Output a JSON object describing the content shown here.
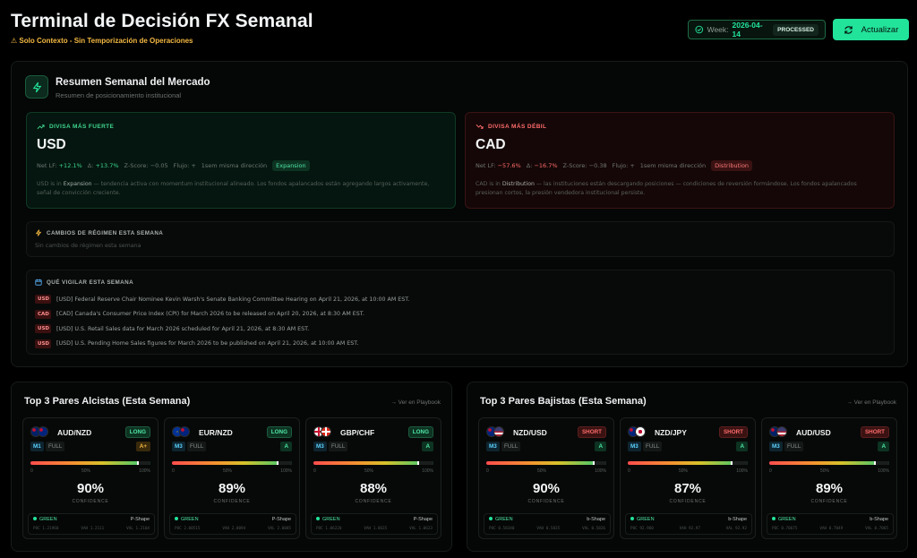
{
  "header": {
    "title": "Terminal de Decisión FX Semanal",
    "subtitle": "⚠ Solo Contexto - Sin Temporización de Operaciones",
    "week_label": "Week:",
    "week_value": "2026-04-14",
    "status": "PROCESSED",
    "refresh_label": "Actualizar"
  },
  "summary": {
    "title": "Resumen Semanal del Mercado",
    "subtitle": "Resumen de posicionamiento institucional",
    "strong": {
      "label": "DIVISA MÁS FUERTE",
      "currency": "USD",
      "net_lf_label": "Net LF:",
      "net_lf": "+12.1%",
      "delta_label": "Δ:",
      "delta": "+13.7%",
      "zscore": "Z-Score: −0.05",
      "flow": "Flujo: +",
      "same_dir": "1sem misma dirección",
      "regime": "Expansion",
      "desc_pre": "USD is in ",
      "desc_regime": "Expansion",
      "desc_post": " — tendencia activa con momentum institucional alineado. Los fondos apalancados están agregando largos activamente, señal de convicción creciente."
    },
    "weak": {
      "label": "DIVISA MÁS DÉBIL",
      "currency": "CAD",
      "net_lf_label": "Net LF:",
      "net_lf": "−57.6%",
      "delta_label": "Δ:",
      "delta": "−16.7%",
      "zscore": "Z-Score: −0.38",
      "flow": "Flujo: +",
      "same_dir": "1sem misma dirección",
      "regime": "Distribution",
      "desc_pre": "CAD is in ",
      "desc_regime": "Distribution",
      "desc_post": " — las instituciones están descargando posiciones — condiciones de reversión formándose. Los fondos apalancados presionan cortos, la presión vendedora institucional persiste."
    },
    "regime_changes": {
      "title": "CAMBIOS DE RÉGIMEN ESTA SEMANA",
      "empty": "Sin cambios de régimen esta semana"
    },
    "watch": {
      "title": "QUÉ VIGILAR ESTA SEMANA",
      "events": [
        {
          "tag": "USD",
          "text": "[USD] Federal Reserve Chair Nominee Kevin Warsh's Senate Banking Committee Hearing on April 21, 2026, at 10:00 AM EST."
        },
        {
          "tag": "CAD",
          "text": "[CAD] Canada's Consumer Price Index (CPI) for March 2026 to be released on April 20, 2026, at 8:30 AM EST."
        },
        {
          "tag": "USD",
          "text": "[USD] U.S. Retail Sales data for March 2026 scheduled for April 21, 2026, at 8:30 AM EST."
        },
        {
          "tag": "USD",
          "text": "[USD] U.S. Pending Home Sales figures for March 2026 to be published on April 21, 2026, at 10:00 AM EST."
        }
      ]
    }
  },
  "bullish": {
    "title": "Top 3 Pares Alcistas (Esta Semana)",
    "link": "→ Ver en Playbook",
    "pairs": [
      {
        "pair": "AUD/NZD",
        "dir": "LONG",
        "tf": "M1",
        "mode": "FULL",
        "grade": "A+",
        "confidence": 0.9,
        "pct": "90%",
        "status": "GREEN",
        "shape": "P-Shape",
        "poc": "POC 1.21960",
        "vah": "VAH 1.2111",
        "val": "VAL 1.2104"
      },
      {
        "pair": "EUR/NZD",
        "dir": "LONG",
        "tf": "M3",
        "mode": "FULL",
        "grade": "A",
        "confidence": 0.89,
        "pct": "89%",
        "status": "GREEN",
        "shape": "P-Shape",
        "poc": "POC 2.00515",
        "vah": "VAH 2.0094",
        "val": "VAL 2.0005"
      },
      {
        "pair": "GBP/CHF",
        "dir": "LONG",
        "tf": "M3",
        "mode": "FULL",
        "grade": "A",
        "confidence": 0.88,
        "pct": "88%",
        "status": "GREEN",
        "shape": "P-Shape",
        "poc": "POC 1.06220",
        "vah": "VAH 1.0635",
        "val": "VAL 1.0623"
      }
    ]
  },
  "bearish": {
    "title": "Top 3 Pares Bajistas (Esta Semana)",
    "link": "→ Ver en Playbook",
    "pairs": [
      {
        "pair": "NZD/USD",
        "dir": "SHORT",
        "tf": "M3",
        "mode": "FULL",
        "grade": "A",
        "confidence": 0.9,
        "pct": "90%",
        "status": "GREEN",
        "shape": "b-Shape",
        "poc": "POC 0.58340",
        "vah": "VAH 0.5835",
        "val": "VAL 0.5826"
      },
      {
        "pair": "NZD/JPY",
        "dir": "SHORT",
        "tf": "M3",
        "mode": "FULL",
        "grade": "A",
        "confidence": 0.87,
        "pct": "87%",
        "status": "GREEN",
        "shape": "b-Shape",
        "poc": "POC 92.960",
        "vah": "VAH 92.97",
        "val": "VAL 92.92"
      },
      {
        "pair": "AUD/USD",
        "dir": "SHORT",
        "tf": "M3",
        "mode": "FULL",
        "grade": "A",
        "confidence": 0.89,
        "pct": "89%",
        "status": "GREEN",
        "shape": "b-Shape",
        "poc": "POC 0.70675",
        "vah": "VAH 0.7049",
        "val": "VAL 0.7065"
      }
    ]
  },
  "colors": {
    "accent": "#22e39a",
    "bull": "#4ee6a4",
    "bear": "#ff6b6b",
    "warn": "#f5b942"
  }
}
